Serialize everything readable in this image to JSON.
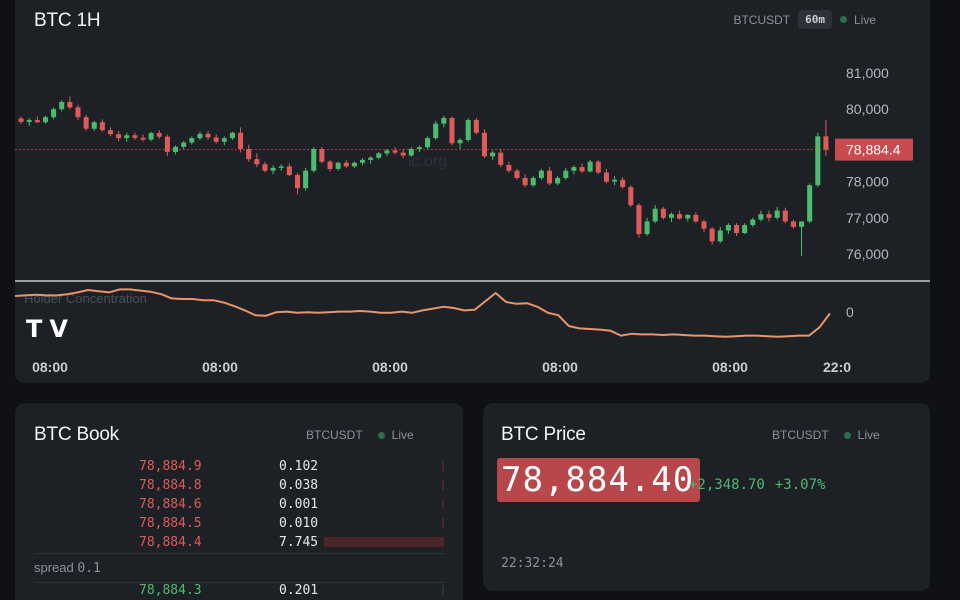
{
  "chart_panel": {
    "title": "BTC 1H",
    "symbol": "BTCUSDT",
    "interval": "60m",
    "live_label": "Live",
    "last_price_tag": "78,884.4",
    "indicator_label": "Holder Concentration",
    "indicator_zero_label": "0",
    "watermark_text": "ic.org",
    "logo_text": "TV"
  },
  "chart_data": {
    "type": "candlestick",
    "y_ticks": [
      "81,000",
      "80,000",
      "78,000",
      "77,000",
      "76,000"
    ],
    "y_tick_values": [
      81000,
      80000,
      78000,
      77000,
      76000
    ],
    "x_tick_labels": [
      "08:00",
      "08:00",
      "08:00",
      "08:00",
      "08:00",
      "22:0"
    ],
    "last_price": 78884.4,
    "candles": [
      [
        79742,
        79800,
        79590,
        79650
      ],
      [
        79650,
        79755,
        79540,
        79700
      ],
      [
        79700,
        79800,
        79620,
        79640
      ],
      [
        79640,
        79820,
        79600,
        79780
      ],
      [
        79780,
        80050,
        79720,
        80000
      ],
      [
        80000,
        80250,
        79940,
        80200
      ],
      [
        80200,
        80350,
        80000,
        80050
      ],
      [
        80050,
        80120,
        79700,
        79780
      ],
      [
        79780,
        79850,
        79400,
        79460
      ],
      [
        79460,
        79680,
        79400,
        79640
      ],
      [
        79640,
        79720,
        79380,
        79420
      ],
      [
        79420,
        79500,
        79250,
        79310
      ],
      [
        79310,
        79400,
        79120,
        79200
      ],
      [
        79200,
        79350,
        79100,
        79280
      ],
      [
        79280,
        79350,
        79150,
        79210
      ],
      [
        79210,
        79300,
        79110,
        79160
      ],
      [
        79160,
        79380,
        79120,
        79340
      ],
      [
        79340,
        79420,
        79180,
        79240
      ],
      [
        79240,
        79300,
        78700,
        78820
      ],
      [
        78820,
        79000,
        78750,
        78960
      ],
      [
        78960,
        79120,
        78900,
        79080
      ],
      [
        79080,
        79250,
        79020,
        79200
      ],
      [
        79200,
        79380,
        79150,
        79320
      ],
      [
        79320,
        79400,
        79150,
        79220
      ],
      [
        79220,
        79300,
        79050,
        79100
      ],
      [
        79100,
        79250,
        79000,
        79200
      ],
      [
        79200,
        79380,
        79150,
        79350
      ],
      [
        79350,
        79500,
        78800,
        78900
      ],
      [
        78900,
        79020,
        78550,
        78620
      ],
      [
        78620,
        78780,
        78400,
        78480
      ],
      [
        78480,
        78550,
        78250,
        78300
      ],
      [
        78300,
        78450,
        78200,
        78380
      ],
      [
        78380,
        78480,
        78300,
        78420
      ],
      [
        78420,
        78500,
        78150,
        78180
      ],
      [
        78180,
        78240,
        77650,
        77820
      ],
      [
        77820,
        78380,
        77750,
        78300
      ],
      [
        78300,
        78950,
        78250,
        78900
      ],
      [
        78900,
        78950,
        78500,
        78550
      ],
      [
        78550,
        78600,
        78280,
        78350
      ],
      [
        78350,
        78550,
        78300,
        78520
      ],
      [
        78520,
        78600,
        78380,
        78420
      ],
      [
        78420,
        78560,
        78380,
        78520
      ],
      [
        78520,
        78650,
        78450,
        78600
      ],
      [
        78600,
        78700,
        78500,
        78660
      ],
      [
        78660,
        78820,
        78620,
        78780
      ],
      [
        78780,
        78900,
        78700,
        78860
      ],
      [
        78860,
        78950,
        78750,
        78800
      ],
      [
        78800,
        78900,
        78650,
        78720
      ],
      [
        78720,
        78950,
        78680,
        78900
      ],
      [
        78900,
        79000,
        78820,
        78950
      ],
      [
        78950,
        79250,
        78900,
        79200
      ],
      [
        79200,
        79680,
        79150,
        79600
      ],
      [
        79600,
        79820,
        79500,
        79760
      ],
      [
        79760,
        79800,
        79000,
        79060
      ],
      [
        79060,
        79200,
        78900,
        79150
      ],
      [
        79150,
        79750,
        79100,
        79700
      ],
      [
        79700,
        79760,
        79300,
        79350
      ],
      [
        79350,
        79450,
        78650,
        78700
      ],
      [
        78700,
        78850,
        78600,
        78800
      ],
      [
        78800,
        78900,
        78400,
        78460
      ],
      [
        78460,
        78550,
        78250,
        78300
      ],
      [
        78300,
        78350,
        78050,
        78100
      ],
      [
        78100,
        78200,
        77850,
        77900
      ],
      [
        77900,
        78150,
        77850,
        78100
      ],
      [
        78100,
        78350,
        78050,
        78300
      ],
      [
        78300,
        78400,
        77900,
        77950
      ],
      [
        77950,
        78150,
        77900,
        78100
      ],
      [
        78100,
        78380,
        78050,
        78300
      ],
      [
        78300,
        78450,
        78200,
        78400
      ],
      [
        78400,
        78500,
        78250,
        78280
      ],
      [
        78280,
        78600,
        78250,
        78550
      ],
      [
        78550,
        78600,
        78200,
        78250
      ],
      [
        78250,
        78350,
        77950,
        78000
      ],
      [
        78000,
        78150,
        77900,
        78050
      ],
      [
        78050,
        78120,
        77800,
        77850
      ],
      [
        77850,
        77900,
        77300,
        77350
      ],
      [
        77350,
        77400,
        76450,
        76550
      ],
      [
        76550,
        77000,
        76500,
        76900
      ],
      [
        76900,
        77350,
        76850,
        77250
      ],
      [
        77250,
        77300,
        76950,
        77000
      ],
      [
        77000,
        77150,
        76880,
        77100
      ],
      [
        77100,
        77200,
        76950,
        76980
      ],
      [
        76980,
        77100,
        76900,
        77080
      ],
      [
        77080,
        77150,
        76850,
        76900
      ],
      [
        76900,
        76950,
        76600,
        76700
      ],
      [
        76700,
        76750,
        76250,
        76350
      ],
      [
        76350,
        76750,
        76300,
        76650
      ],
      [
        76650,
        76850,
        76550,
        76800
      ],
      [
        76800,
        76850,
        76500,
        76580
      ],
      [
        76580,
        76850,
        76550,
        76800
      ],
      [
        76800,
        77000,
        76750,
        76950
      ],
      [
        76950,
        77200,
        76900,
        77100
      ],
      [
        77100,
        77200,
        76900,
        77000
      ],
      [
        77000,
        77300,
        76950,
        77200
      ],
      [
        77200,
        77280,
        76850,
        76900
      ],
      [
        76900,
        76950,
        76700,
        76750
      ],
      [
        76750,
        76800,
        75950,
        76900
      ],
      [
        76900,
        77950,
        76850,
        77900
      ],
      [
        77900,
        79350,
        77850,
        79250
      ],
      [
        79250,
        79700,
        78700,
        78884.4
      ]
    ],
    "indicator_line": [
      0.3,
      0.31,
      0.32,
      0.31,
      0.31,
      0.33,
      0.36,
      0.4,
      0.38,
      0.36,
      0.41,
      0.41,
      0.39,
      0.37,
      0.33,
      0.26,
      0.25,
      0.25,
      0.23,
      0.23,
      0.19,
      0.13,
      0.06,
      -0.02,
      -0.03,
      0.03,
      0.04,
      0.02,
      0.03,
      0.02,
      0.03,
      0.04,
      0.04,
      0.05,
      0.04,
      0.02,
      0.02,
      0.04,
      0.02,
      0.06,
      0.09,
      0.12,
      0.1,
      0.06,
      0.07,
      0.21,
      0.35,
      0.2,
      0.17,
      0.18,
      0.12,
      0.02,
      -0.02,
      -0.2,
      -0.24,
      -0.25,
      -0.26,
      -0.28,
      -0.36,
      -0.33,
      -0.34,
      -0.34,
      -0.35,
      -0.34,
      -0.35,
      -0.36,
      -0.36,
      -0.37,
      -0.38,
      -0.37,
      -0.36,
      -0.36,
      -0.37,
      -0.38,
      -0.37,
      -0.36,
      -0.36,
      -0.22,
      0.01
    ]
  },
  "book_panel": {
    "title": "BTC Book",
    "symbol": "BTCUSDT",
    "live_label": "Live",
    "asks": [
      {
        "price": "78,884.9",
        "qty": "0.102",
        "depth": 0.004
      },
      {
        "price": "78,884.8",
        "qty": "0.038",
        "depth": 0.0
      },
      {
        "price": "78,884.6",
        "qty": "0.001",
        "depth": 0.0
      },
      {
        "price": "78,884.5",
        "qty": "0.010",
        "depth": 0.0
      },
      {
        "price": "78,884.4",
        "qty": "7.745",
        "depth": 1.0
      }
    ],
    "spread_label": "spread",
    "spread_value": "0.1",
    "bids": [
      {
        "price": "78,884.3",
        "qty": "0.201",
        "depth": 0.008
      }
    ]
  },
  "price_panel": {
    "title": "BTC Price",
    "symbol": "BTCUSDT",
    "live_label": "Live",
    "price": "78,884.40",
    "change_abs": "+2,348.70",
    "change_pct": "+3.07%",
    "time": "22:32:24"
  },
  "colors": {
    "up": "#4cbb6f",
    "down": "#e05a5a",
    "indicator": "#e8956a",
    "price_tag": "#c94a4f",
    "background": "#0f1114",
    "panel": "#1d2126"
  }
}
